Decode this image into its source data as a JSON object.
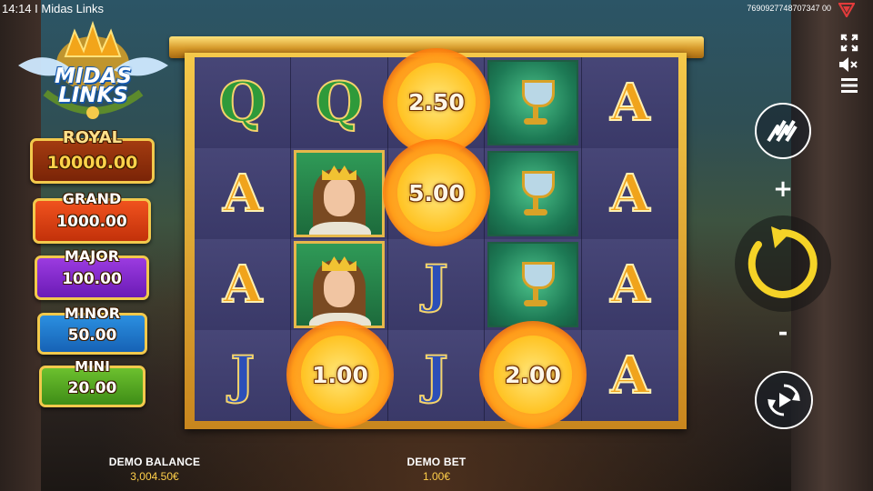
{
  "status_bar": {
    "time": "14:14",
    "title": "Midas Links",
    "time_title": "14:14 I Midas Links",
    "session_id": "7690927748707347 00"
  },
  "logo": {
    "line1": "MIDAS",
    "line2": "LINKS"
  },
  "jackpots": [
    {
      "name": "ROYAL",
      "value": "10000.00",
      "color": "#a33b10"
    },
    {
      "name": "GRAND",
      "value": "1000.00",
      "color": "#f0521e"
    },
    {
      "name": "MAJOR",
      "value": "100.00",
      "color": "#9b3be0"
    },
    {
      "name": "MINOR",
      "value": "50.00",
      "color": "#2b8fe0"
    },
    {
      "name": "MINI",
      "value": "20.00",
      "color": "#6cc02e"
    }
  ],
  "reels": {
    "rows": [
      [
        "Q",
        "Q",
        "fireball",
        "chalice",
        "A"
      ],
      [
        "A",
        "queen",
        "fireball",
        "chalice",
        "A"
      ],
      [
        "A",
        "queen",
        "J",
        "chalice",
        "A"
      ],
      [
        "J",
        "fireball",
        "J",
        "fireball",
        "A"
      ]
    ],
    "fireball_values": [
      "2.50",
      "5.00",
      "1.00",
      "2.00"
    ]
  },
  "controls": {
    "plus": "+",
    "minus": "-",
    "icons": [
      "fullscreen-icon",
      "sound-muted-icon",
      "menu-icon",
      "turbo-icon",
      "spin-icon",
      "autoplay-icon"
    ]
  },
  "footer": {
    "balance_label": "DEMO BALANCE",
    "balance_value": "3,004.50€",
    "bet_label": "DEMO BET",
    "bet_value": "1.00€"
  },
  "colors": {
    "frame_gold": "#f5c94a",
    "reel_bg": "#3b3a6b",
    "spin_yellow": "#f5d327"
  }
}
